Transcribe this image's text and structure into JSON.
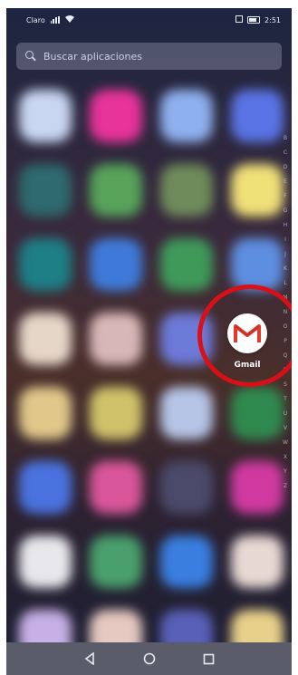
{
  "status": {
    "carrier": "Claro",
    "time": "2:51"
  },
  "search": {
    "placeholder": "Buscar aplicaciones"
  },
  "index_letters": [
    "B",
    "C",
    "D",
    "E",
    "F",
    "G",
    "H",
    "I",
    "J",
    "K",
    "L",
    "M",
    "N",
    "O",
    "P",
    "Q",
    "R",
    "S",
    "T",
    "U",
    "V",
    "W",
    "X",
    "Y",
    "Z"
  ],
  "highlighted_app": {
    "label": "Gmail"
  },
  "colors": {
    "ring": "#d91018",
    "gmail_red": "#e03a2f",
    "navbar": "#5b5c69"
  },
  "icons": [
    "search-icon",
    "back-icon",
    "home-icon",
    "recents-icon",
    "gmail-icon",
    "signal-icon",
    "wifi-icon",
    "battery-icon"
  ]
}
